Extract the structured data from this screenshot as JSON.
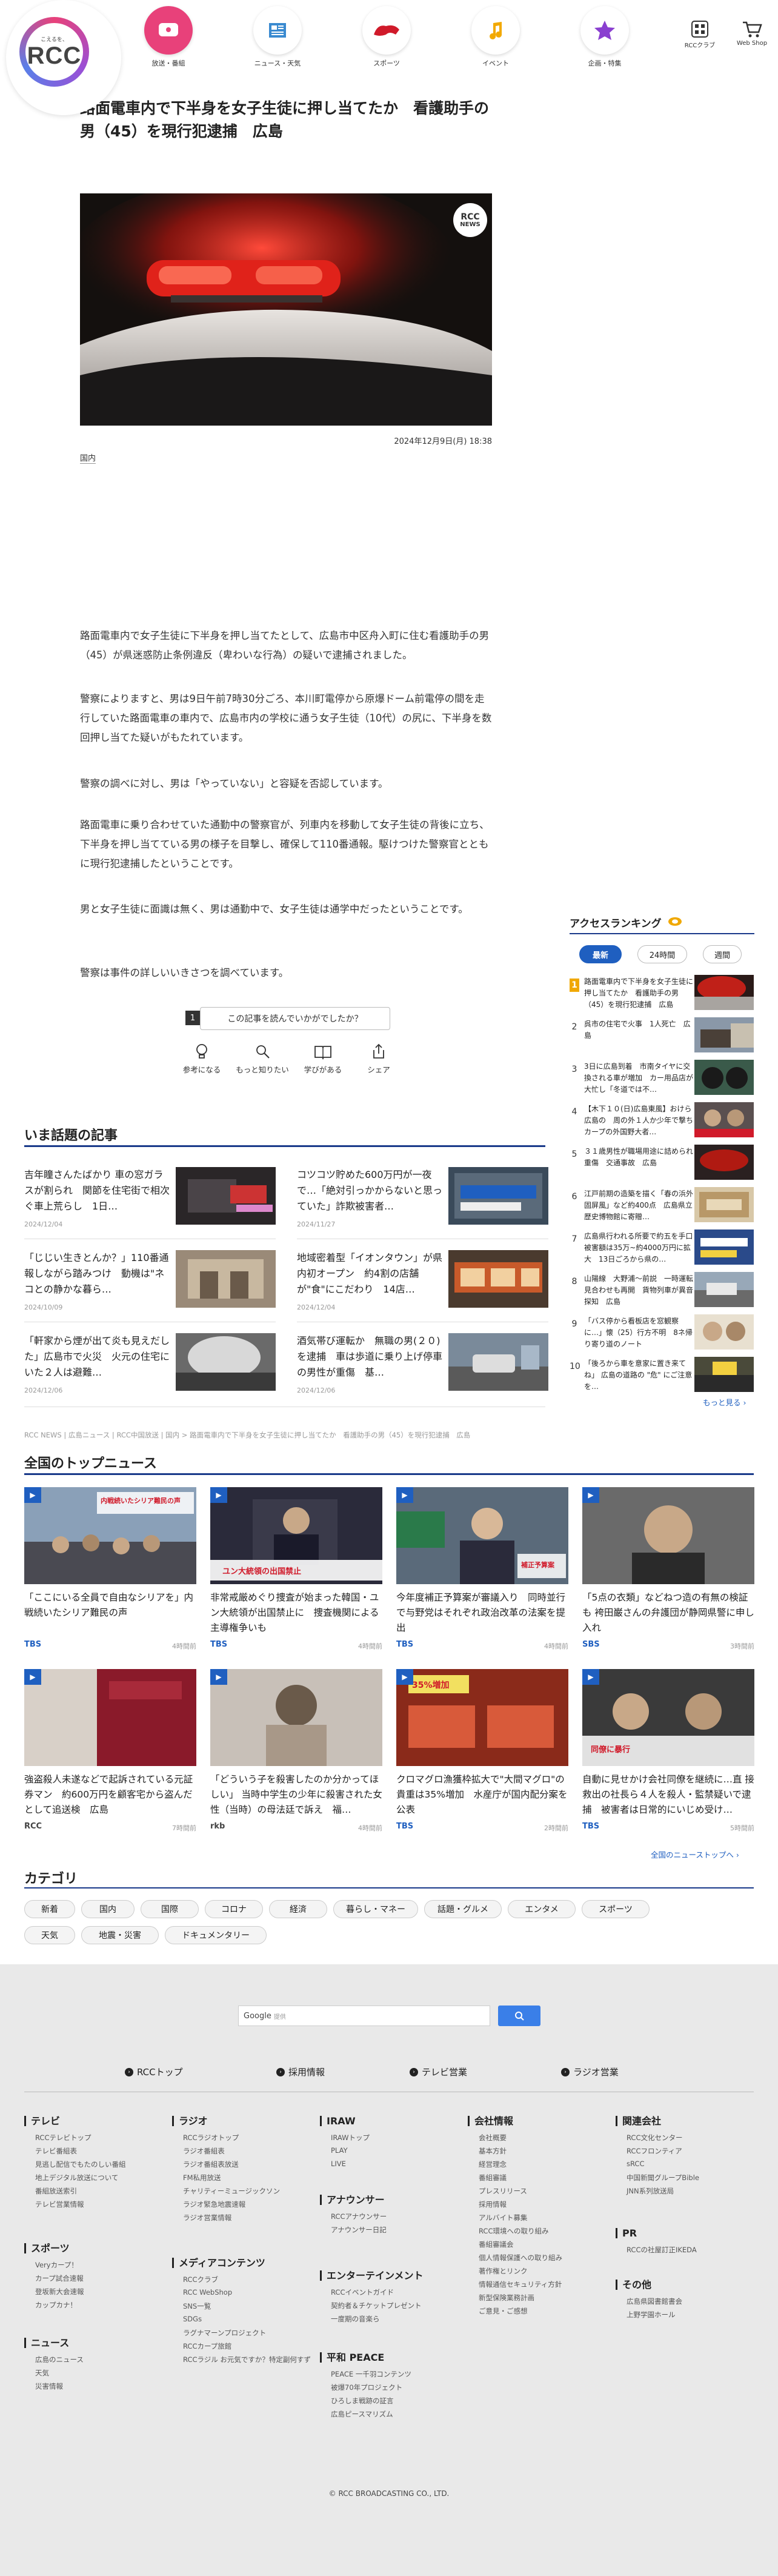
{
  "header": {
    "logo_sub": "こえるを、",
    "logo_text": "RCC",
    "nav": [
      {
        "label": "放送・番組",
        "icon": "tv-icon"
      },
      {
        "label": "ニュース・天気",
        "icon": "newspaper-icon"
      },
      {
        "label": "スポーツ",
        "icon": "carp-icon"
      },
      {
        "label": "イベント",
        "icon": "music-note-icon"
      },
      {
        "label": "企画・特集",
        "icon": "star-icon"
      }
    ],
    "util": [
      {
        "label": "RCCクラブ",
        "icon": "grid-icon"
      },
      {
        "label": "Web Shop",
        "icon": "cart-icon"
      }
    ]
  },
  "article": {
    "title": "路面電車内で下半身を女子生徒に押し当てたか　看護助手の男（45）を現行犯逮捕　広島",
    "hero_badge_line1": "RCC",
    "hero_badge_line2": "NEWS",
    "date": "2024年12月9日(月) 18:38",
    "tag": "国内",
    "paragraphs": [
      "路面電車内で女子生徒に下半身を押し当てたとして、広島市中区舟入町に住む看護助手の男（45）が県迷惑防止条例違反（卑わいな行為）の疑いで逮捕されました。",
      "警察によりますと、男は9日午前7時30分ごろ、本川町電停から原爆ドーム前電停の間を走行していた路面電車の車内で、広島市内の学校に通う女子生徒（10代）の尻に、下半身を数回押し当てた疑いがもたれています。",
      "警察の調べに対し、男は「やっていない」と容疑を否認しています。",
      "路面電車に乗り合わせていた通勤中の警察官が、列車内を移動して女子生徒の背後に立ち、下半身を押し当てている男の様子を目撃し、確保して110番通報。駆けつけた警察官とともに現行犯逮捕したということです。",
      "男と女子生徒に面識は無く、男は通勤中で、女子生徒は通学中だったということです。",
      "警察は事件の詳しいいきさつを調べています。"
    ],
    "feedback_num": "1",
    "feedback_label": "この記事を読んでいかがでしたか？",
    "feedback_items": [
      {
        "label": "参考になる",
        "icon": "lightbulb-icon"
      },
      {
        "label": "もっと知りたい",
        "icon": "magnifier-icon"
      },
      {
        "label": "学びがある",
        "icon": "book-icon"
      },
      {
        "label": "シェア",
        "icon": "share-icon"
      }
    ]
  },
  "trending": {
    "title": "いま話題の記事",
    "items": [
      {
        "text": "吉年瞳さんたばかり 車の窓ガラスが割られ　関節を住宅街で相次ぐ車上荒らし　1日…",
        "date": "2024/12/04"
      },
      {
        "text": "コツコツ貯めた600万円が一夜で…「絶対引っかからないと思っていた」詐欺被害者…",
        "date": "2024/11/27"
      },
      {
        "text": "「じじい生きとんか？」110番通報しながら踏みつけ　動機は\"ネコとの静かな暮ら…",
        "date": "2024/10/09"
      },
      {
        "text": "地域密着型「イオンタウン」が県内初オープン　約4割の店舗が\"食\"にこだわり　14店…",
        "date": "2024/12/04"
      },
      {
        "text": "「軒家から煙が出て炎も見えだした」広島市で火災　火元の住宅にいた２人は避難…",
        "date": "2024/12/06"
      },
      {
        "text": "酒気帯び運転か　無職の男(２０)を逮捕　車は歩道に乗り上げ停車の男性が重傷　基…",
        "date": "2024/12/06"
      }
    ]
  },
  "breadcrumb": "RCC NEWS | 広島ニュース | RCC中国放送 | 国内 > 路面電車内で下半身を女子生徒に押し当てたか　看護助手の男（45）を現行犯逮捕　広島",
  "national": {
    "title": "全国のトップニュース",
    "items": [
      {
        "text": "「ここにいる全員で自由なシリアを」内戦続いたシリア難民の声",
        "source": "TBS",
        "time": "4時間前",
        "overlay": "内戦続いたシリア難民の声"
      },
      {
        "text": "非常戒厳めぐり捜査が始まった韓国・ユン大統領が出国禁止に　捜査機関による主導権争いも",
        "source": "TBS",
        "time": "4時間前",
        "overlay": "ユン大統領の出国禁止"
      },
      {
        "text": "今年度補正予算案が審議入り　同時並行で与野党はそれぞれ政治改革の法案を提出",
        "source": "TBS",
        "time": "4時間前",
        "overlay": "補正予算案"
      },
      {
        "text": "「5点の衣類」などねつ造の有無の検証も 袴田巌さんの弁護団が静岡県警に申し入れ",
        "source": "SBS",
        "time": "3時間前",
        "overlay": ""
      },
      {
        "text": "強盗殺人未遂などで起訴されている元証券マン　約600万円を顧客宅から盗んだとして追送検　広島",
        "source": "RCC",
        "time": "7時間前",
        "overlay": ""
      },
      {
        "text": "「どういう子を殺害したのか分かってほしい」 当時中学生の少年に殺害された女性（当時）の母法廷で訴え　福…",
        "source": "rkb",
        "time": "4時間前",
        "overlay": ""
      },
      {
        "text": "クロマグロ漁獲枠拡大で\"大間マグロ\"の貴重は35%増加　水産庁が国内配分案を公表",
        "source": "TBS",
        "time": "2時間前",
        "overlay": "35%増加"
      },
      {
        "text": "自動に見せかけ会社同僚を継続に…直 接救出の社長ら４人を殺人・監禁疑いで逮捕　被害者は日常的にいじめ受け…",
        "source": "TBS",
        "time": "5時間前",
        "overlay": "同僚に暴行"
      }
    ],
    "more": "全国のニューストップへ"
  },
  "ranking": {
    "title": "アクセスランキング",
    "tabs": [
      "最新",
      "24時間",
      "週間"
    ],
    "items": [
      {
        "num": "1",
        "text": "路面電車内で下半身を女子生徒に押し当てたか　看護助手の男（45）を現行犯逮捕　広島"
      },
      {
        "num": "2",
        "text": "呉市の住宅で火事　1人死亡　広島"
      },
      {
        "num": "3",
        "text": "3日に広島到着　市南タイヤに交換される車が増加　カー用品店が大忙し「冬道では不…"
      },
      {
        "num": "4",
        "text": "【木下１０(日)広島東風】おけら広島の　周の外１人か少年で撃ち　カープの外国野大者…"
      },
      {
        "num": "5",
        "text": "３１歳男性が職場用途に詰められ重傷　交通事故　広島"
      },
      {
        "num": "6",
        "text": "江戸前期の造築を描く「春の浜外固屏風」など約400点　広島県立歴史博物館に寄贈…"
      },
      {
        "num": "7",
        "text": "広島県行われる所要で約五を手口　被害額は35万~約4000万円に拡大　13日ごろから県の…"
      },
      {
        "num": "8",
        "text": "山陽線　大野浦～前説　一時運転見合わせも再開　貨物列車が異音探知　広島"
      },
      {
        "num": "9",
        "text": "「バス停から看板店を窓観察に…」懐（25）行方不明　8ネ帰り寄り道のノート"
      },
      {
        "num": "10",
        "text": "「後ろから車を意家に置き来てね」 広島の道路の \"危\" にご注意を…"
      }
    ],
    "more": "もっと見る"
  },
  "categories": {
    "title": "カテゴリ",
    "items": [
      "新着",
      "国内",
      "国際",
      "コロナ",
      "経済",
      "暮らし・マネー",
      "話題・グルメ",
      "エンタメ",
      "スポーツ",
      "天気",
      "地震・災害",
      "ドキュメンタリー"
    ]
  },
  "footer": {
    "search_brand": "Google",
    "search_placeholder": "提供",
    "top_links": [
      "RCCトップ",
      "採用情報",
      "テレビ営業",
      "ラジオ営業"
    ],
    "columns": [
      {
        "head": "テレビ",
        "links": [
          "RCCテレビトップ",
          "テレビ番組表",
          "見逃し配信でもたのしい番組",
          "地上デジタル放送について",
          "番組放送索引",
          "テレビ営業情報"
        ]
      },
      {
        "head": "スポーツ",
        "links": [
          "Veryカープ！",
          "カープ試合速報",
          "登坂新大会速報",
          "カップカナ！"
        ]
      },
      {
        "head": "ニュース",
        "links": [
          "広島のニュース",
          "天気",
          "災害情報"
        ]
      },
      {
        "head": "ラジオ",
        "links": [
          "RCCラジオトップ",
          "ラジオ番組表",
          "ラジオ番組表放送",
          "FM私用放送",
          "チャリティーミュージックソン",
          "ラジオ緊急地震速報",
          "ラジオ営業情報"
        ]
      },
      {
        "head": "メディアコンテンツ",
        "links": [
          "RCCクラブ",
          "RCC WebShop",
          "SNS一覧",
          "SDGs",
          "ラグナマーンプロジェクト",
          "RCCカープ旅館",
          "RCCラジル お元気ですか？特定副何すず"
        ]
      },
      {
        "head": "IRAW",
        "links": [
          "IRAWトップ",
          "PLAY",
          "LIVE"
        ]
      },
      {
        "head": "アナウンサー",
        "links": [
          "RCCアナウンサー",
          "アナウンサー日記"
        ]
      },
      {
        "head": "エンターテインメント",
        "links": [
          "RCCイベントガイド",
          "契約者＆チケットプレゼント",
          "一度期の音楽ら"
        ]
      },
      {
        "head": "平和 PEACE",
        "links": [
          "PEACE 一千羽コンテンツ",
          "被爆70年プロジェクト",
          "ひろしま戦跡の証言",
          "広島ピースマリズム"
        ]
      },
      {
        "head": "会社情報",
        "links": [
          "会社概要",
          "基本方針",
          "経営理念",
          "番組審議",
          "プレスリリース",
          "採用情報",
          "アルバイト募集",
          "RCC環境への取り組み",
          "番組審議会",
          "個人情報保護への取り組み",
          "著作権とリンク",
          "情報通信セキュリティ方針",
          "新型保険業務計画",
          "ご意見・ご感想"
        ]
      },
      {
        "head": "関連会社",
        "links": [
          "RCC文化センター",
          "RCCフロンティア",
          "sRCC",
          "中国新聞グループBible",
          "JNN系列放送局"
        ]
      },
      {
        "head": "PR",
        "links": [
          "RCCの社屋訂正IKEDA"
        ]
      },
      {
        "head": "その他",
        "links": [
          "広島県図書館書会",
          "上野学園ホール"
        ]
      }
    ],
    "copyright": "© RCC BROADCASTING CO., LTD."
  }
}
